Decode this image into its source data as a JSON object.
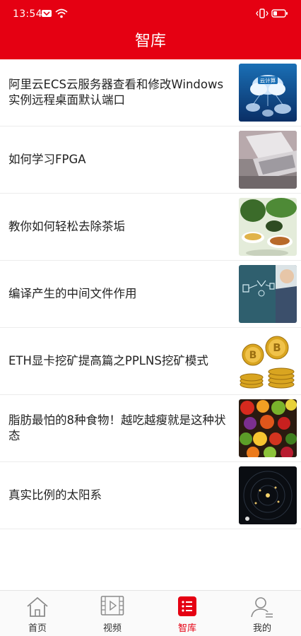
{
  "status_bar": {
    "time": "13:54"
  },
  "header": {
    "title": "智库"
  },
  "articles": [
    {
      "title": "阿里云ECS云服务器查看和修改Windows实例远程桌面默认端口",
      "thumb_label": "云计算"
    },
    {
      "title": "如何学习FPGA"
    },
    {
      "title": "教你如何轻松去除茶垢"
    },
    {
      "title": "编译产生的中间文件作用"
    },
    {
      "title": "ETH显卡挖矿提高篇之PPLNS挖矿模式"
    },
    {
      "title": "脂肪最怕的8种食物！越吃越瘦就是这种状态"
    },
    {
      "title": "真实比例的太阳系"
    }
  ],
  "tabs": [
    {
      "label": "首页"
    },
    {
      "label": "视频"
    },
    {
      "label": "智库",
      "active": true
    },
    {
      "label": "我的"
    }
  ],
  "colors": {
    "brand": "#e50012",
    "tab_inactive": "#333333"
  },
  "icons": {
    "status": [
      "mail-notification-icon",
      "wifi-icon",
      "vibrate-icon",
      "battery-icon"
    ],
    "tabs": [
      "home-icon",
      "video-icon",
      "list-icon",
      "profile-icon"
    ]
  }
}
